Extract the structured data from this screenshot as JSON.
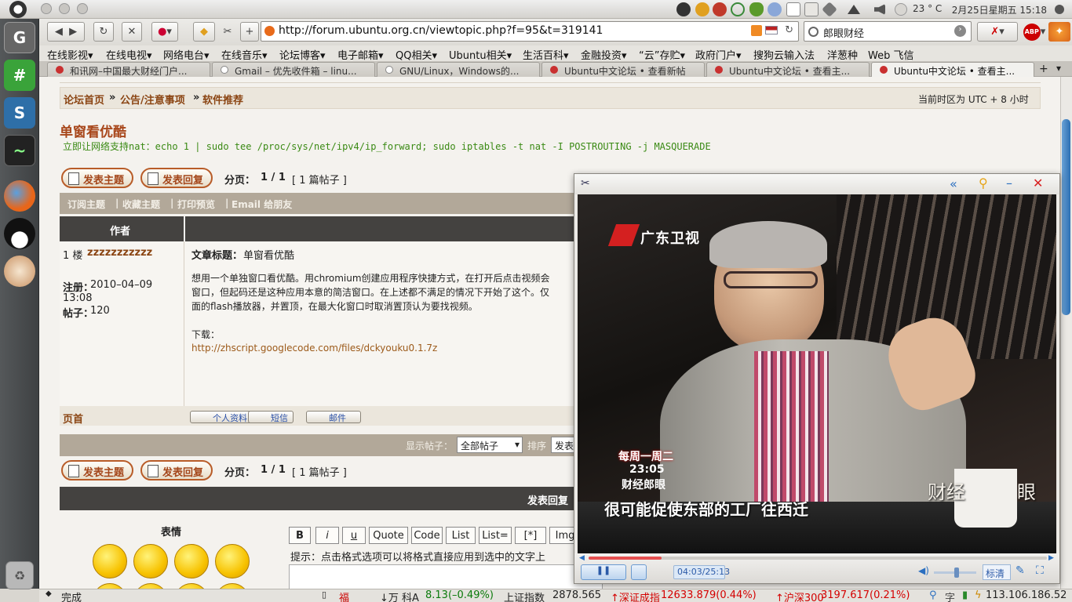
{
  "panel": {
    "weather": "23 ° C",
    "clock": "2月25日星期五 15:18"
  },
  "browser": {
    "url": "http://forum.ubuntu.org.cn/viewtopic.php?f=95&t=319141",
    "search_value": "郎眼财经",
    "abp": "ABP"
  },
  "bookmarks": [
    {
      "label": "在线影视▾"
    },
    {
      "label": "在线电视▾"
    },
    {
      "label": "网络电台▾"
    },
    {
      "label": "在线音乐▾"
    },
    {
      "label": "论坛博客▾"
    },
    {
      "label": "电子邮箱▾"
    },
    {
      "label": "QQ相关▾"
    },
    {
      "label": "Ubuntu相关▾"
    },
    {
      "label": "生活百科▾"
    },
    {
      "label": "金融投资▾"
    },
    {
      "label": "“云”存贮▾"
    },
    {
      "label": "政府门户▾"
    },
    {
      "label": "搜狗云输入法"
    },
    {
      "label": "洋葱种"
    },
    {
      "label": "Web 飞信"
    }
  ],
  "tabs": [
    {
      "label": "和讯网–中国最大财经门户..."
    },
    {
      "label": "Gmail – 优先收件箱 – linu..."
    },
    {
      "label": "GNU/Linux，Windows的..."
    },
    {
      "label": "Ubuntu中文论坛 • 查看新帖"
    },
    {
      "label": "Ubuntu中文论坛 • 查看主..."
    },
    {
      "label": "Ubuntu中文论坛 • 查看主..."
    }
  ],
  "forum": {
    "breadcrumb_home": "论坛首页",
    "breadcrumb_sep": "»",
    "breadcrumb_section": "公告/注意事项",
    "breadcrumb_sub": "软件推荐",
    "timezone": "当前时区为 UTC + 8 小时",
    "topic_title": "单窗看优酷",
    "tip": "立即让网络支持nat：echo 1 | sudo tee /proc/sys/net/ipv4/ip_forward; sudo iptables -t nat -I POSTROUTING -j MASQUERADE",
    "new_topic": "发表主题",
    "reply": "发表回复",
    "pages_label": "分页：",
    "pages": "1 / 1",
    "count": "[ 1 篇帖子 ]",
    "subscribe": "订阅主题",
    "bookmark": "收藏主题",
    "print": "打印预览",
    "email_friend": "Email 给朋友",
    "author_header": "作者",
    "post_floor": "1 楼",
    "post_author": "zzzzzzzzzzz",
    "article_title_label": "文章标题：",
    "article_title": "单窗看优酷",
    "reg_label": "注册：",
    "reg_date": "2010–04–09",
    "reg_time": "13:08",
    "posts_label": "帖子：",
    "posts_count": "120",
    "body_line1": "想用一个单独窗口看优酷。用chromium创建应用程序快捷方式，在打开后点击视频会",
    "body_line2": "窗口，但起码还是这种应用本意的简洁窗口。在上述都不满足的情况下开始了这个。仅",
    "body_line3": "面的flash播放器，并置顶，在最大化窗口时取消置顶认为要找视频。",
    "download_label": "下载：",
    "download_link": "http://zhscript.googlecode.com/files/dckyouku0.1.7z",
    "top_link": "页首",
    "profile_btn": "个人资料",
    "pm_btn": "短信",
    "mail_btn": "邮件",
    "display_label": "显示帖子：",
    "display_value": "全部帖子",
    "sort_label": "排序",
    "sort_value": "发表",
    "quick_reply": "发表回复",
    "smilies_label": "表情",
    "fmt_buttons": [
      "B",
      "i",
      "u",
      "Quote",
      "Code",
      "List",
      "List=",
      "[*]",
      "Img"
    ],
    "hint": "提示：点击格式选项可以将格式直接应用到选中的文字上"
  },
  "video": {
    "channel": "广东卫视",
    "caption_schedule1": "每周一周二",
    "caption_schedule2": "23:05",
    "caption_show": "财经郎眼",
    "subtitle": "很可能促使东部的工厂往西迁",
    "logo_text": "财经",
    "logo_text2": "眼",
    "time": "04:03/25:13",
    "quality": "标清",
    "progress": 0.16,
    "volume": 0.55
  },
  "status": {
    "done": "完成",
    "s1": "↓万 科A",
    "s1v": "8.13(–0.49%)",
    "s2": "上证指数",
    "s2v": "2878.565",
    "s3": "↑深证成指",
    "s3v": "12633.879(0.44%)",
    "s4": "↑沪深300",
    "s4v": "3197.617(0.21%)",
    "ip": "113.106.186.52"
  },
  "colors": {
    "accent": "#a4461a",
    "link": "#2b51a8",
    "green_tip": "#3a8a14",
    "red_stock": "#d40000"
  }
}
